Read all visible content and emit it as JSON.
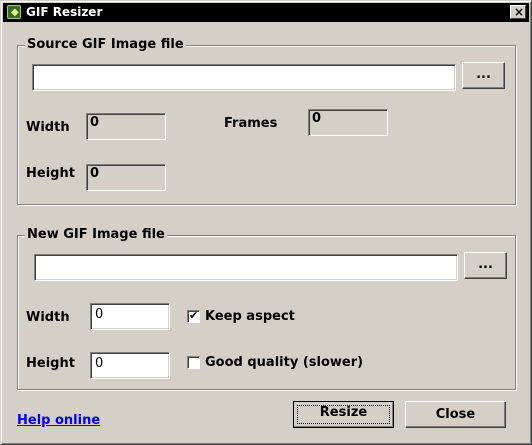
{
  "window": {
    "title": "GIF Resizer",
    "close_glyph": "×",
    "icon": "gif-resizer-app-icon"
  },
  "source": {
    "legend": "Source GIF Image file",
    "path_value": "",
    "browse_label": "...",
    "width_label": "Width",
    "width_value": "0",
    "frames_label": "Frames",
    "frames_value": "0",
    "height_label": "Height",
    "height_value": "0"
  },
  "target": {
    "legend": "New GIF Image file",
    "path_value": "",
    "browse_label": "...",
    "width_label": "Width",
    "width_value": "0",
    "height_label": "Height",
    "height_value": "0",
    "keep_aspect_label": "Keep aspect",
    "keep_aspect_checked": true,
    "keep_aspect_mark": "✔",
    "good_quality_label": "Good quality (slower)",
    "good_quality_checked": false
  },
  "footer": {
    "help_link": "Help online",
    "resize_label": "Resize",
    "close_label": "Close"
  }
}
